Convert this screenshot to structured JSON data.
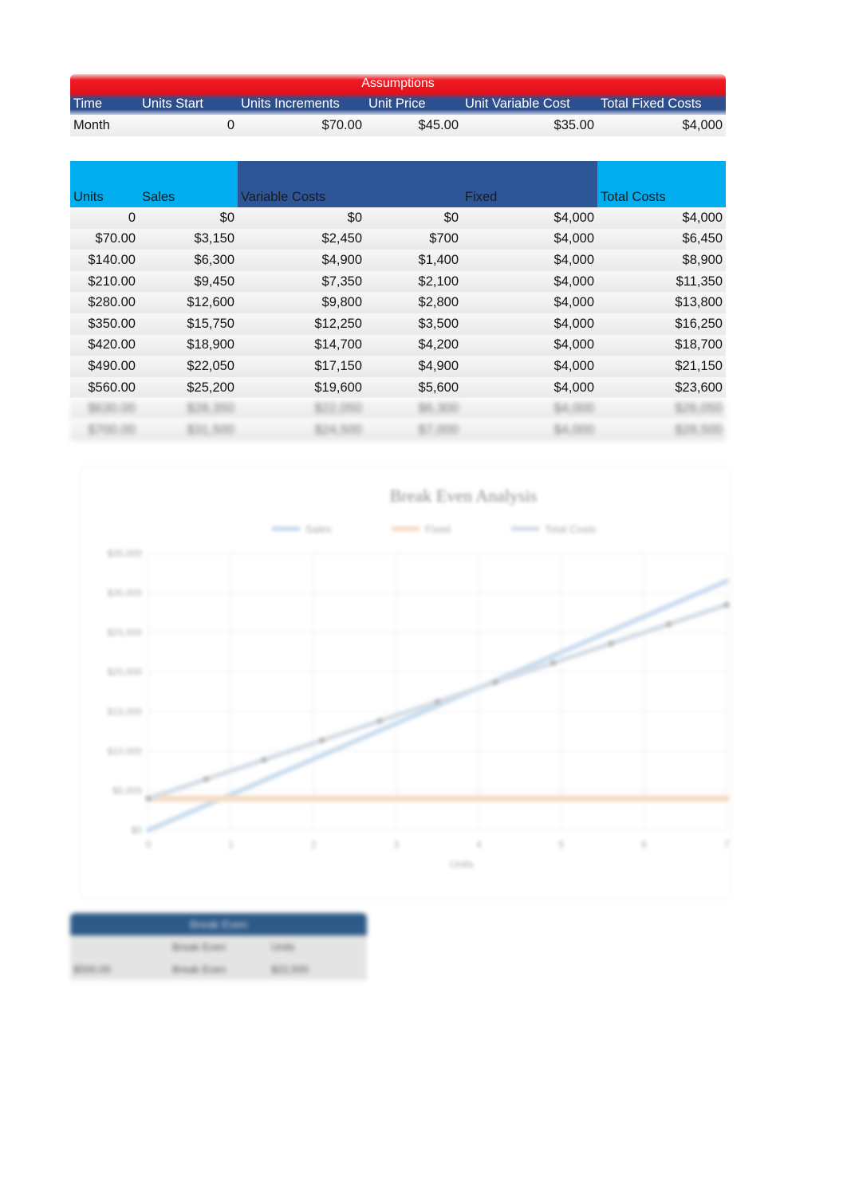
{
  "assumptions": {
    "title": "Assumptions",
    "headers": [
      "Time",
      "Units Start",
      "Units Increments",
      "Unit Price",
      "Unit Variable Cost",
      "Total Fixed Costs"
    ],
    "values": [
      "Month",
      "0",
      "$70.00",
      "$45.00",
      "$35.00",
      "$4,000"
    ]
  },
  "break_even_table": {
    "headers": [
      "Units",
      "Sales",
      "Variable Costs",
      "",
      "Fixed",
      "Total Costs"
    ],
    "rows": [
      [
        "0",
        "$0",
        "$0",
        "$0",
        "$4,000",
        "$4,000"
      ],
      [
        "$70.00",
        "$3,150",
        "$2,450",
        "$700",
        "$4,000",
        "$6,450"
      ],
      [
        "$140.00",
        "$6,300",
        "$4,900",
        "$1,400",
        "$4,000",
        "$8,900"
      ],
      [
        "$210.00",
        "$9,450",
        "$7,350",
        "$2,100",
        "$4,000",
        "$11,350"
      ],
      [
        "$280.00",
        "$12,600",
        "$9,800",
        "$2,800",
        "$4,000",
        "$13,800"
      ],
      [
        "$350.00",
        "$15,750",
        "$12,250",
        "$3,500",
        "$4,000",
        "$16,250"
      ],
      [
        "$420.00",
        "$18,900",
        "$14,700",
        "$4,200",
        "$4,000",
        "$18,700"
      ],
      [
        "$490.00",
        "$22,050",
        "$17,150",
        "$4,900",
        "$4,000",
        "$21,150"
      ],
      [
        "$560.00",
        "$25,200",
        "$19,600",
        "$5,600",
        "$4,000",
        "$23,600"
      ],
      [
        "$630.00",
        "$28,350",
        "$22,050",
        "$6,300",
        "$4,000",
        "$26,050"
      ],
      [
        "$700.00",
        "$31,500",
        "$24,500",
        "$7,000",
        "$4,000",
        "$28,500"
      ]
    ],
    "blurred_row_count": 2
  },
  "chart_data": {
    "type": "line",
    "title": "Break Even Analysis",
    "xlabel": "Units",
    "ylabel": "",
    "x": [
      0,
      1,
      2,
      3,
      4,
      5,
      6,
      7,
      8,
      9,
      10
    ],
    "x_ticks": [
      "0",
      "1",
      "2",
      "3",
      "4",
      "5",
      "6",
      "7"
    ],
    "y_ticks": [
      "$0",
      "$5,000",
      "$10,000",
      "$15,000",
      "$20,000",
      "$25,000",
      "$30,000",
      "$35,000"
    ],
    "ylim": [
      0,
      35000
    ],
    "grid": true,
    "legend": "top",
    "series": [
      {
        "name": "Sales",
        "color": "#c7dbee",
        "values": [
          0,
          3150,
          6300,
          9450,
          12600,
          15750,
          18900,
          22050,
          25200,
          28350,
          31500
        ]
      },
      {
        "name": "Fixed",
        "color": "#f6dcc4",
        "values": [
          4000,
          4000,
          4000,
          4000,
          4000,
          4000,
          4000,
          4000,
          4000,
          4000,
          4000
        ]
      },
      {
        "name": "Total Costs",
        "color": "#d5dde6",
        "values": [
          4000,
          6450,
          8900,
          11350,
          13800,
          16250,
          18700,
          21150,
          23600,
          26050,
          28500
        ]
      }
    ]
  },
  "summary": {
    "title": "Break Even",
    "rows": [
      [
        "",
        "Break Even",
        "Units"
      ],
      [
        "$500.00",
        "Break Even",
        "$22,500"
      ]
    ]
  }
}
